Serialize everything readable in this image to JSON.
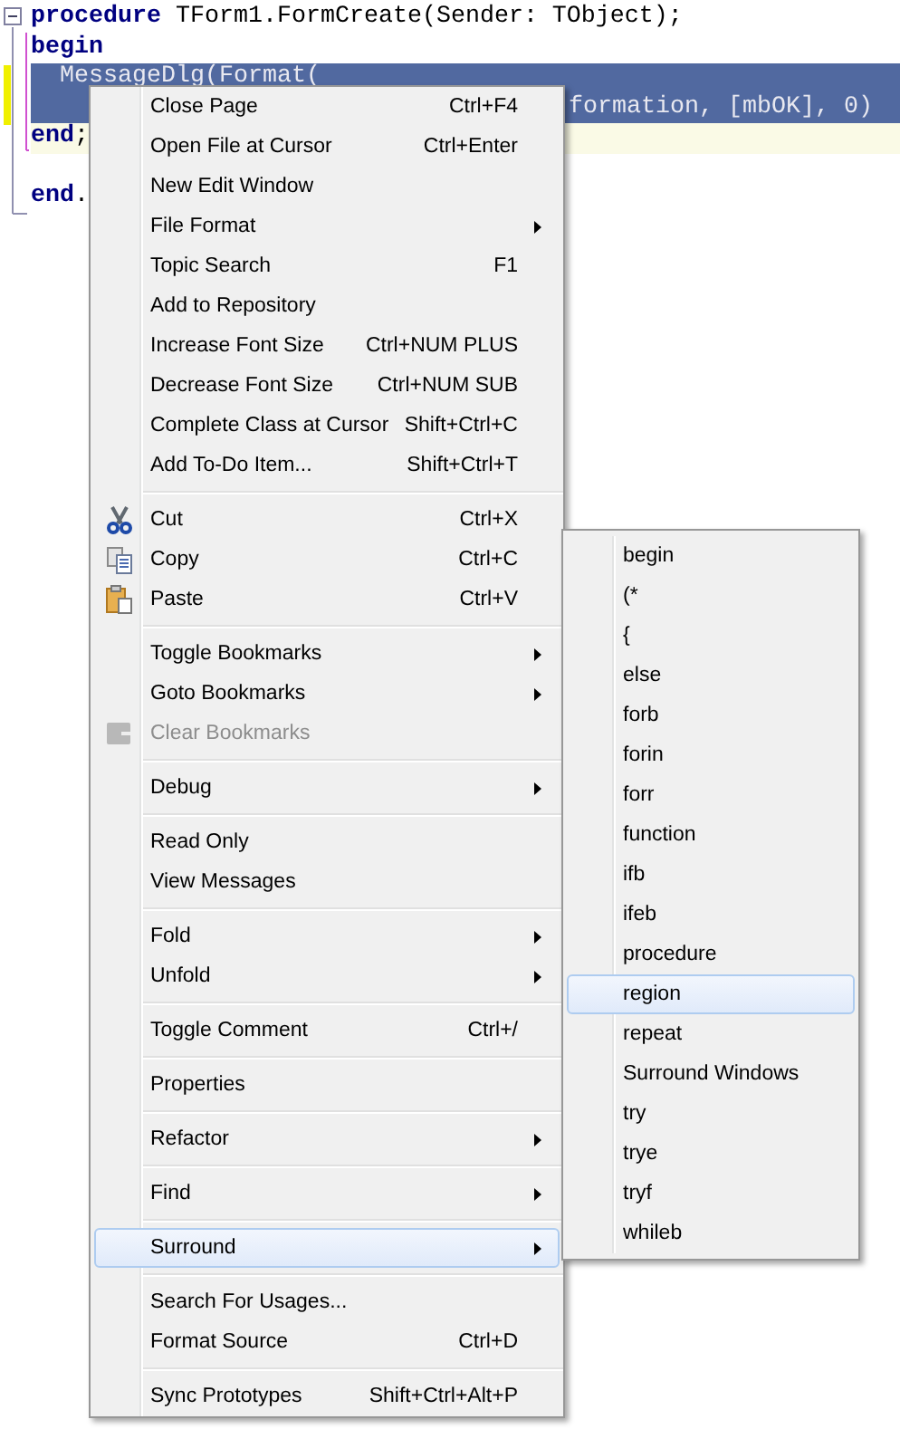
{
  "editor": {
    "lines": [
      {
        "text": "**procedure** TForm1.FormCreate(Sender: TObject);",
        "selected": false,
        "current": false
      },
      {
        "text": "**begin**",
        "selected": false,
        "current": false
      },
      {
        "text": "  MessageDlg(Format(",
        "selected": true,
        "current": false
      },
      {
        "text": "formation, [mbOK], 0)",
        "selected": true,
        "current": false
      },
      {
        "text": "**end**;",
        "selected": false,
        "current": true
      },
      {
        "selected": false,
        "current": false
      },
      {
        "text": "**end**.",
        "selected": false,
        "current": false
      }
    ]
  },
  "context_menu": {
    "items": [
      {
        "kind": "item",
        "label": "Close Page",
        "shortcut": "Ctrl+F4",
        "submenu": false,
        "disabled": false,
        "selected": false
      },
      {
        "kind": "item",
        "label": "Open File at Cursor",
        "shortcut": "Ctrl+Enter",
        "submenu": false,
        "disabled": false,
        "selected": false
      },
      {
        "kind": "item",
        "label": "New Edit Window",
        "submenu": false,
        "disabled": false,
        "selected": false
      },
      {
        "kind": "item",
        "label": "File Format",
        "submenu": true,
        "disabled": false,
        "selected": false
      },
      {
        "kind": "item",
        "label": "Topic Search",
        "shortcut": "F1",
        "submenu": false,
        "disabled": false,
        "selected": false
      },
      {
        "kind": "item",
        "label": "Add to Repository",
        "submenu": false,
        "disabled": false,
        "selected": false
      },
      {
        "kind": "item",
        "label": "Increase Font Size",
        "shortcut": "Ctrl+NUM PLUS",
        "submenu": false,
        "disabled": false,
        "selected": false
      },
      {
        "kind": "item",
        "label": "Decrease Font Size",
        "shortcut": "Ctrl+NUM SUB",
        "submenu": false,
        "disabled": false,
        "selected": false
      },
      {
        "kind": "item",
        "label": "Complete Class at Cursor",
        "shortcut": "Shift+Ctrl+C",
        "submenu": false,
        "disabled": false,
        "selected": false
      },
      {
        "kind": "item",
        "label": "Add To-Do Item...",
        "shortcut": "Shift+Ctrl+T",
        "submenu": false,
        "disabled": false,
        "selected": false
      },
      {
        "kind": "separator"
      },
      {
        "kind": "item",
        "label": "Cut",
        "shortcut": "Ctrl+X",
        "submenu": false,
        "disabled": false,
        "selected": false
      },
      {
        "kind": "item",
        "label": "Copy",
        "shortcut": "Ctrl+C",
        "submenu": false,
        "disabled": false,
        "selected": false
      },
      {
        "kind": "item",
        "label": "Paste",
        "shortcut": "Ctrl+V",
        "submenu": false,
        "disabled": false,
        "selected": false
      },
      {
        "kind": "separator"
      },
      {
        "kind": "item",
        "label": "Toggle Bookmarks",
        "submenu": true,
        "disabled": false,
        "selected": false
      },
      {
        "kind": "item",
        "label": "Goto Bookmarks",
        "submenu": true,
        "disabled": false,
        "selected": false
      },
      {
        "kind": "item",
        "label": "Clear Bookmarks",
        "submenu": false,
        "disabled": true,
        "selected": false
      },
      {
        "kind": "separator"
      },
      {
        "kind": "item",
        "label": "Debug",
        "submenu": true,
        "disabled": false,
        "selected": false
      },
      {
        "kind": "separator"
      },
      {
        "kind": "item",
        "label": "Read Only",
        "submenu": false,
        "disabled": false,
        "selected": false
      },
      {
        "kind": "item",
        "label": "View Messages",
        "submenu": false,
        "disabled": false,
        "selected": false
      },
      {
        "kind": "separator"
      },
      {
        "kind": "item",
        "label": "Fold",
        "submenu": true,
        "disabled": false,
        "selected": false
      },
      {
        "kind": "item",
        "label": "Unfold",
        "submenu": true,
        "disabled": false,
        "selected": false
      },
      {
        "kind": "separator"
      },
      {
        "kind": "item",
        "label": "Toggle Comment",
        "shortcut": "Ctrl+/",
        "submenu": false,
        "disabled": false,
        "selected": false
      },
      {
        "kind": "separator"
      },
      {
        "kind": "item",
        "label": "Properties",
        "submenu": false,
        "disabled": false,
        "selected": false
      },
      {
        "kind": "separator"
      },
      {
        "kind": "item",
        "label": "Refactor",
        "submenu": true,
        "disabled": false,
        "selected": false
      },
      {
        "kind": "separator"
      },
      {
        "kind": "item",
        "label": "Find",
        "submenu": true,
        "disabled": false,
        "selected": false
      },
      {
        "kind": "separator"
      },
      {
        "kind": "item",
        "label": "Surround",
        "submenu": true,
        "disabled": false,
        "selected": true
      },
      {
        "kind": "separator"
      },
      {
        "kind": "item",
        "label": "Search For Usages...",
        "submenu": false,
        "disabled": false,
        "selected": false
      },
      {
        "kind": "item",
        "label": "Format Source",
        "shortcut": "Ctrl+D",
        "submenu": false,
        "disabled": false,
        "selected": false
      },
      {
        "kind": "separator"
      },
      {
        "kind": "item",
        "label": "Sync Prototypes",
        "shortcut": "Shift+Ctrl+Alt+P",
        "submenu": false,
        "disabled": false,
        "selected": false
      }
    ]
  },
  "surround_submenu": {
    "items": [
      {
        "label": "begin",
        "selected": false
      },
      {
        "label": "(*",
        "selected": false
      },
      {
        "label": "{",
        "selected": false
      },
      {
        "label": "else",
        "selected": false
      },
      {
        "label": "forb",
        "selected": false
      },
      {
        "label": "forin",
        "selected": false
      },
      {
        "label": "forr",
        "selected": false
      },
      {
        "label": "function",
        "selected": false
      },
      {
        "label": "ifb",
        "selected": false
      },
      {
        "label": "ifeb",
        "selected": false
      },
      {
        "label": "procedure",
        "selected": false
      },
      {
        "label": "region",
        "selected": true
      },
      {
        "label": "repeat",
        "selected": false
      },
      {
        "label": "Surround Windows",
        "selected": false
      },
      {
        "label": "try",
        "selected": false
      },
      {
        "label": "trye",
        "selected": false
      },
      {
        "label": "tryf",
        "selected": false
      },
      {
        "label": "whileb",
        "selected": false
      }
    ]
  }
}
